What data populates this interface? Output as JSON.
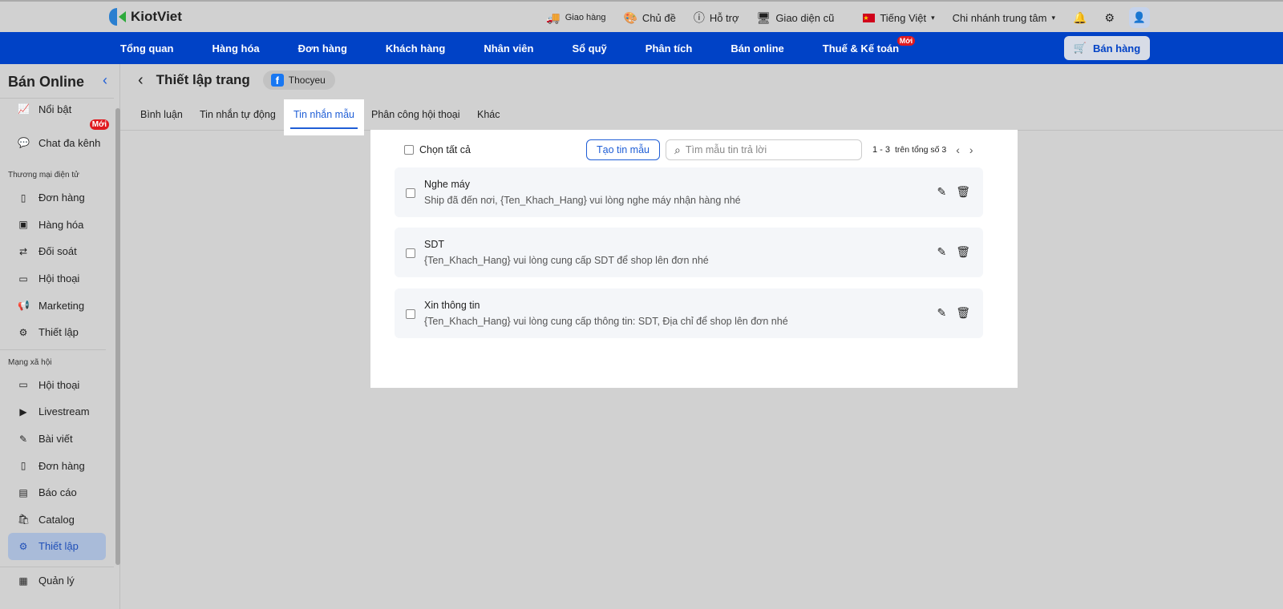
{
  "topbar": {
    "brand": "KiotViet",
    "delivery": "Giao hàng",
    "theme": "Chủ đề",
    "support": "Hỗ trợ",
    "old_ui": "Giao diện cũ",
    "language": "Tiếng Việt",
    "branch": "Chi nhánh trung tâm"
  },
  "nav": {
    "items": [
      "Tổng quan",
      "Hàng hóa",
      "Đơn hàng",
      "Khách hàng",
      "Nhân viên",
      "Sổ quỹ",
      "Phân tích",
      "Bán online",
      "Thuế & Kế toán"
    ],
    "new_badge": "Mới",
    "sell_button": "Bán hàng"
  },
  "sidebar": {
    "title": "Bán Online",
    "top_items": [
      {
        "label": "Nổi bật"
      },
      {
        "label": "Chat đa kênh",
        "badge": "Mới"
      }
    ],
    "sections": [
      {
        "title": "Thương mại điện tử",
        "items": [
          "Đơn hàng",
          "Hàng hóa",
          "Đối soát",
          "Hội thoại",
          "Marketing",
          "Thiết lập"
        ]
      },
      {
        "title": "Mạng xã hội",
        "items": [
          "Hội thoại",
          "Livestream",
          "Bài viết",
          "Đơn hàng",
          "Báo cáo",
          "Catalog",
          "Thiết lập"
        ]
      }
    ],
    "bottom_item": "Quản lý"
  },
  "header": {
    "title": "Thiết lập trang",
    "page_name": "Thocyeu"
  },
  "tabs": [
    "Bình luận",
    "Tin nhắn tự động",
    "Tin nhắn mẫu",
    "Phân công hội thoại",
    "Khác"
  ],
  "toolbar": {
    "select_all": "Chọn tất cả",
    "create_button": "Tạo tin mẫu",
    "search_placeholder": "Tìm mẫu tin trả lời",
    "range": "1 - 3",
    "total": "trên tổng số 3"
  },
  "templates": [
    {
      "title": "Nghe máy",
      "content": "Ship đã đến nơi, {Ten_Khach_Hang} vui lòng nghe máy nhận hàng nhé"
    },
    {
      "title": "SDT",
      "content": "{Ten_Khach_Hang} vui lòng cung cấp SDT để shop lên đơn nhé"
    },
    {
      "title": "Xin thông tin",
      "content": "{Ten_Khach_Hang} vui lòng cung cấp thông tin: SDT, Địa chỉ để shop lên đơn nhé"
    }
  ]
}
